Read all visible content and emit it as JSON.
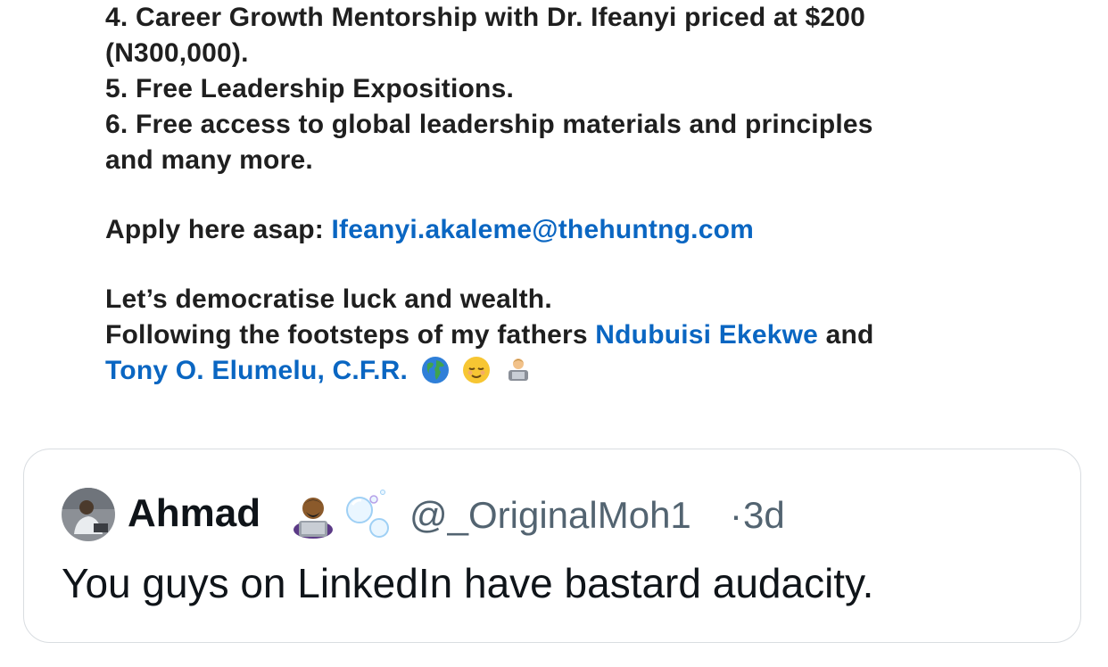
{
  "post": {
    "line1": "4. Career Growth Mentorship with Dr. Ifeanyi priced at $200",
    "line2": "(N300,000).",
    "line3": "5. Free Leadership Expositions.",
    "line4": "6. Free access to global leadership materials and principles",
    "line5": "and many more.",
    "apply_prefix": "Apply here asap: ",
    "apply_email": "Ifeanyi.akaleme@thehuntng.com",
    "closing1": "Let’s democratise luck and wealth.",
    "closing2_prefix": "Following the footsteps of my fathers ",
    "mention1": "Ndubuisi Ekekwe",
    "closing2_suffix": " and",
    "mention2": "Tony O. Elumelu, C.F.R.",
    "emojis": [
      "globe-icon",
      "relieved-face-icon",
      "technologist-icon"
    ]
  },
  "quote_tweet": {
    "display_name": "Ahmad",
    "name_badges": [
      "technologist-icon",
      "bubbles-icon"
    ],
    "handle": "@_OriginalMoh1",
    "separator": "·",
    "age": "3d",
    "text": "You guys on LinkedIn have bastard audacity."
  },
  "colors": {
    "link": "#0a66c2",
    "card_border": "#d9dde1",
    "secondary_text": "#536471"
  }
}
